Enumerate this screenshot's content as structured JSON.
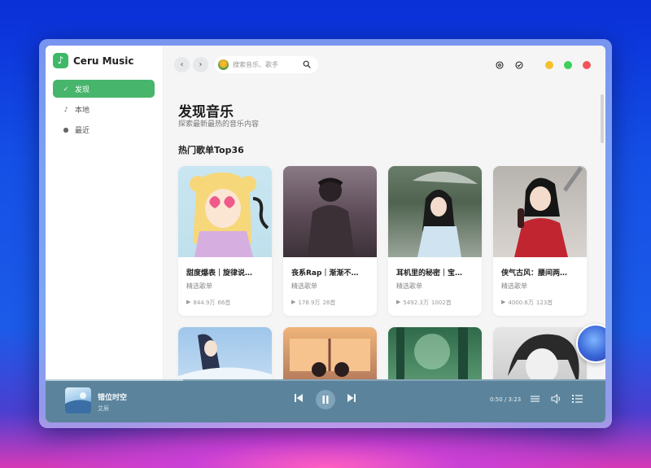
{
  "app": {
    "name": "Ceru Music",
    "logo_glyph": "♪"
  },
  "sidebar": {
    "items": [
      {
        "label": "发现",
        "icon": "compass-icon",
        "glyph": "✓",
        "active": true
      },
      {
        "label": "本地",
        "icon": "music-note-icon",
        "glyph": "♪",
        "active": false
      },
      {
        "label": "最近",
        "icon": "clock-icon",
        "glyph": "●",
        "active": false
      }
    ]
  },
  "topbar": {
    "back_glyph": "‹",
    "forward_glyph": "›",
    "search_placeholder": "搜索音乐、歌手"
  },
  "main": {
    "title": "发现音乐",
    "subtitle": "探索最新最热的音乐内容",
    "section_title": "热门歌单Top36",
    "play_glyph": "▶",
    "cards": [
      {
        "title": "甜度爆表｜旋律说…",
        "subtitle": "精选歌单",
        "plays": "844.9万",
        "count": "66首"
      },
      {
        "title": "丧系Rap｜渐渐不…",
        "subtitle": "精选歌单",
        "plays": "178.9万",
        "count": "28首"
      },
      {
        "title": "耳机里的秘密｜宝…",
        "subtitle": "精选歌单",
        "plays": "5492.3万",
        "count": "1002首"
      },
      {
        "title": "侠气古风：腰间两…",
        "subtitle": "精选歌单",
        "plays": "4000.6万",
        "count": "123首"
      }
    ]
  },
  "player": {
    "title": "错位时空",
    "artist": "艾辰",
    "time": "0:50 / 3:23",
    "progress": 0.246
  },
  "colors": {
    "accent": "#47b56b",
    "player_bg": "#5b849c",
    "close": "#f2555a",
    "minimize": "#f5c02c",
    "maximize": "#3ecf5b"
  }
}
